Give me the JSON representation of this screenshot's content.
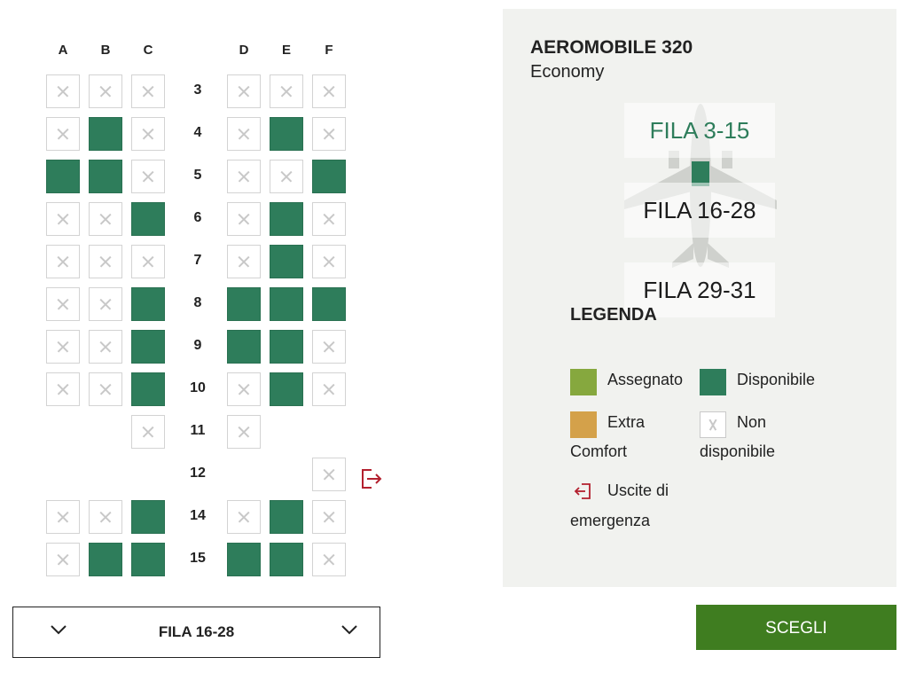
{
  "seatmap": {
    "columns": [
      "A",
      "B",
      "C",
      "D",
      "E",
      "F"
    ],
    "rows": [
      {
        "number": "3",
        "seats": [
          "X",
          "X",
          "X",
          "X",
          "X",
          "X"
        ]
      },
      {
        "number": "4",
        "seats": [
          "X",
          "A",
          "X",
          "X",
          "A",
          "X"
        ]
      },
      {
        "number": "5",
        "seats": [
          "A",
          "A",
          "X",
          "X",
          "X",
          "A"
        ]
      },
      {
        "number": "6",
        "seats": [
          "X",
          "X",
          "A",
          "X",
          "A",
          "X"
        ]
      },
      {
        "number": "7",
        "seats": [
          "X",
          "X",
          "X",
          "X",
          "A",
          "X"
        ]
      },
      {
        "number": "8",
        "seats": [
          "X",
          "X",
          "A",
          "A",
          "A",
          "A"
        ]
      },
      {
        "number": "9",
        "seats": [
          "X",
          "X",
          "A",
          "A",
          "A",
          "X"
        ]
      },
      {
        "number": "10",
        "seats": [
          "X",
          "X",
          "A",
          "X",
          "A",
          "X"
        ]
      },
      {
        "number": "11",
        "seats": [
          "-",
          "-",
          "X",
          "X",
          "-",
          "-"
        ]
      },
      {
        "number": "12",
        "seats": [
          "-",
          "-",
          "-",
          "-",
          "-",
          "X"
        ],
        "emergency_exit": true
      },
      {
        "number": "14",
        "seats": [
          "X",
          "X",
          "A",
          "X",
          "A",
          "X"
        ]
      },
      {
        "number": "15",
        "seats": [
          "X",
          "A",
          "A",
          "A",
          "A",
          "X"
        ]
      }
    ]
  },
  "row_selector": {
    "label": "FILA 16-28"
  },
  "panel": {
    "aircraft": "AEROMOBILE 320",
    "cabin": "Economy",
    "zones": [
      {
        "label": "FILA 3-15",
        "active": true
      },
      {
        "label": "FILA 16-28",
        "active": false
      },
      {
        "label": "FILA 29-31",
        "active": false
      }
    ]
  },
  "legend": {
    "title": "LEGENDA",
    "assigned": "Assegnato",
    "available": "Disponibile",
    "extra_line1": "Extra",
    "extra_line2": "Comfort",
    "not_available_line1": "Non",
    "not_available_line2": "disponibile",
    "exit_line1": "Uscite di",
    "exit_line2": "emergenza"
  },
  "actions": {
    "choose": "SCEGLI"
  },
  "colors": {
    "available": "#2e7d5b",
    "assigned": "#86a83e",
    "extra_comfort": "#d4a14a",
    "exit_icon": "#b3202e",
    "choose_button": "#3f7d20",
    "panel_bg": "#f1f2ef"
  }
}
